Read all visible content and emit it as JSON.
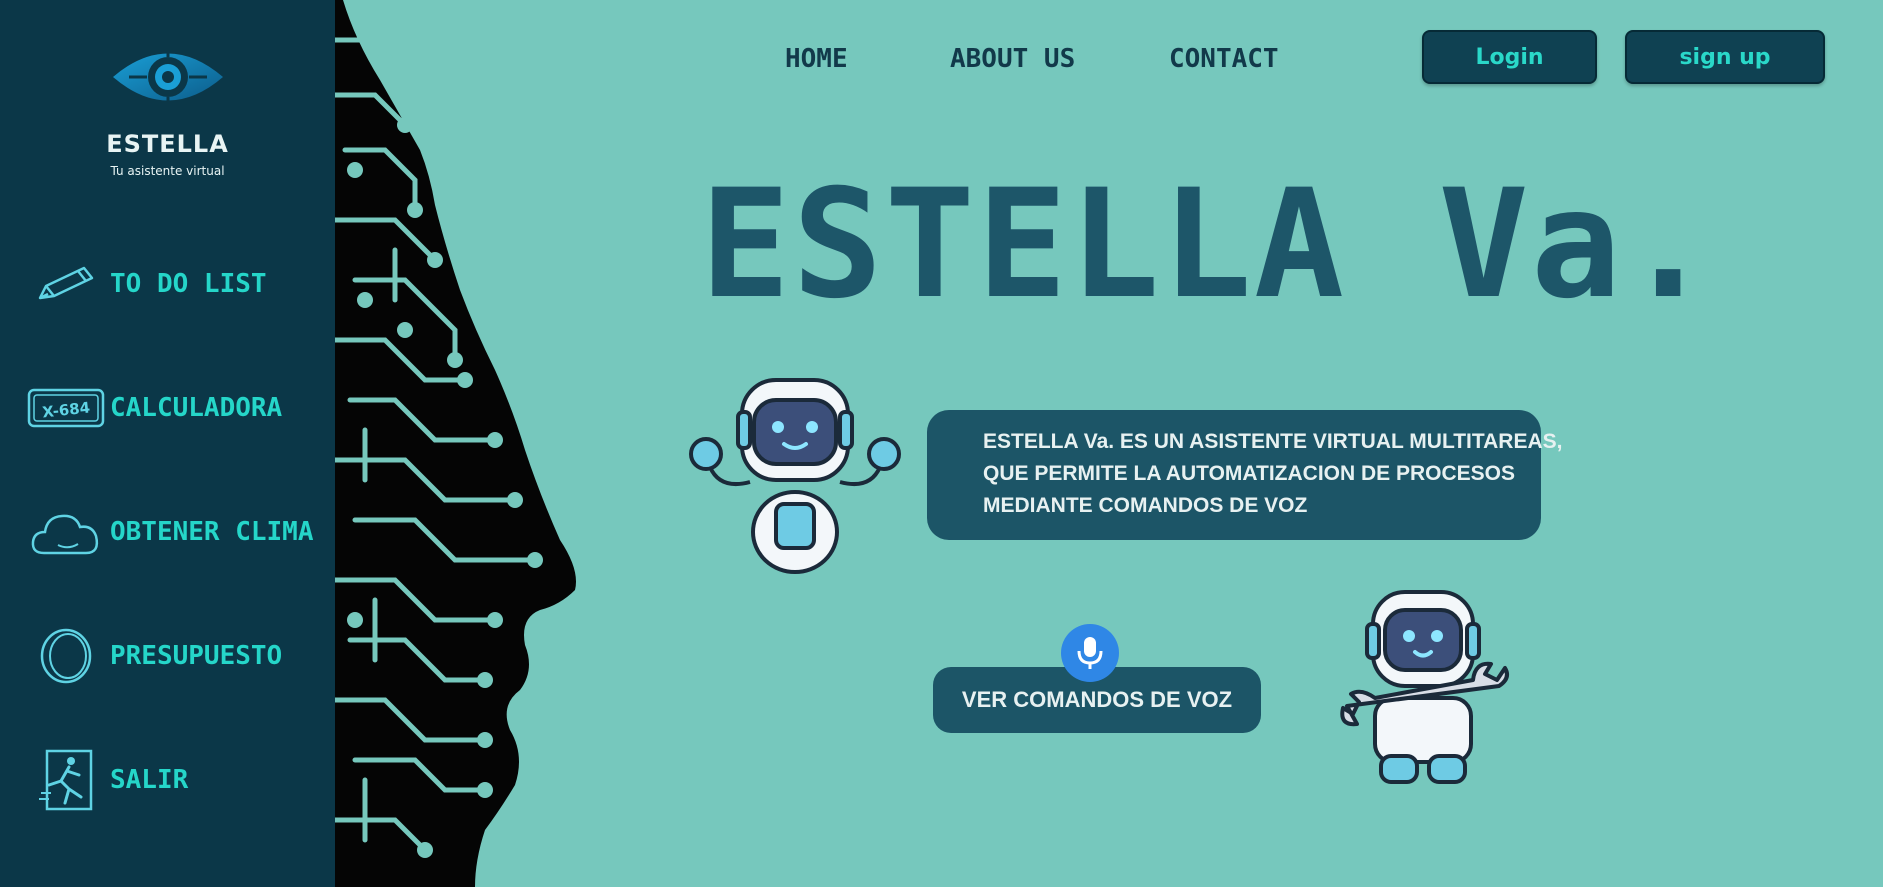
{
  "brand": {
    "name": "ESTELLA",
    "tagline": "Tu asistente virtual",
    "logo_icon": "eye-logo-icon"
  },
  "sidebar": {
    "items": [
      {
        "label": "TO DO LIST",
        "icon": "pencil-icon"
      },
      {
        "label": "CALCULADORA",
        "icon": "license-plate-icon",
        "icon_text": "X-684"
      },
      {
        "label": "OBTENER CLIMA",
        "icon": "cloud-icon"
      },
      {
        "label": "PRESUPUESTO",
        "icon": "coin-icon"
      },
      {
        "label": "SALIR",
        "icon": "exit-running-icon"
      }
    ]
  },
  "topnav": {
    "home": "HOME",
    "about": "ABOUT US",
    "contact": "CONTACT"
  },
  "auth": {
    "login": "Login",
    "signup": "sign up"
  },
  "hero": {
    "title": "ESTELLA Va.",
    "description_lines": [
      "ESTELLA Va. ES UN ASISTENTE VIRTUAL MULTITAREAS,",
      "QUE PERMITE LA AUTOMATIZACION DE PROCESOS",
      "MEDIANTE COMANDOS DE VOZ"
    ],
    "commands_button": "VER COMANDOS DE VOZ",
    "mic_icon": "microphone-icon"
  },
  "colors": {
    "background": "#76c8bd",
    "sidebar": "#0b3748",
    "accent": "#25d6c9",
    "panel": "#1c5567",
    "title": "#1d5669",
    "mic": "#2f87e6"
  }
}
